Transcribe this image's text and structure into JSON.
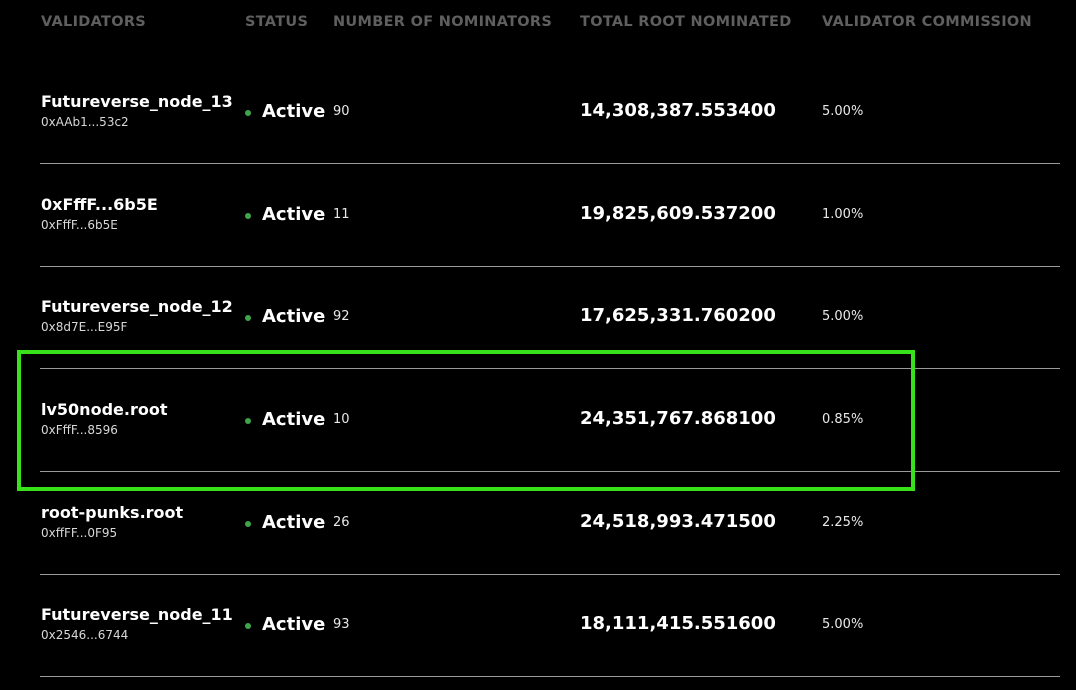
{
  "header": {
    "validators": "VALIDATORS",
    "status": "STATUS",
    "nominators": "NUMBER OF NOMINATORS",
    "total_root": "TOTAL ROOT NOMINATED",
    "commission": "VALIDATOR COMMISSION"
  },
  "rows": [
    {
      "name": "Futureverse_node_13",
      "address": "0xAAb1...53c2",
      "status": "Active",
      "nominators": "90",
      "total": "14,308,387.553400",
      "commission": "5.00%"
    },
    {
      "name": "0xFffF...6b5E",
      "address": "0xFffF...6b5E",
      "status": "Active",
      "nominators": "11",
      "total": "19,825,609.537200",
      "commission": "1.00%"
    },
    {
      "name": "Futureverse_node_12",
      "address": "0x8d7E...E95F",
      "status": "Active",
      "nominators": "92",
      "total": "17,625,331.760200",
      "commission": "5.00%"
    },
    {
      "name": "lv50node.root",
      "address": "0xFffF...8596",
      "status": "Active",
      "nominators": "10",
      "total": "24,351,767.868100",
      "commission": "0.85%"
    },
    {
      "name": "root-punks.root",
      "address": "0xffFF...0F95",
      "status": "Active",
      "nominators": "26",
      "total": "24,518,993.471500",
      "commission": "2.25%"
    },
    {
      "name": "Futureverse_node_11",
      "address": "0x2546...6744",
      "status": "Active",
      "nominators": "93",
      "total": "18,111,415.551600",
      "commission": "5.00%"
    }
  ],
  "colors": {
    "background": "#000000",
    "header_text": "#5f5f5f",
    "active_dot": "#3fa54a",
    "highlight_border": "#39e11b",
    "divider": "#9a9a9a"
  }
}
